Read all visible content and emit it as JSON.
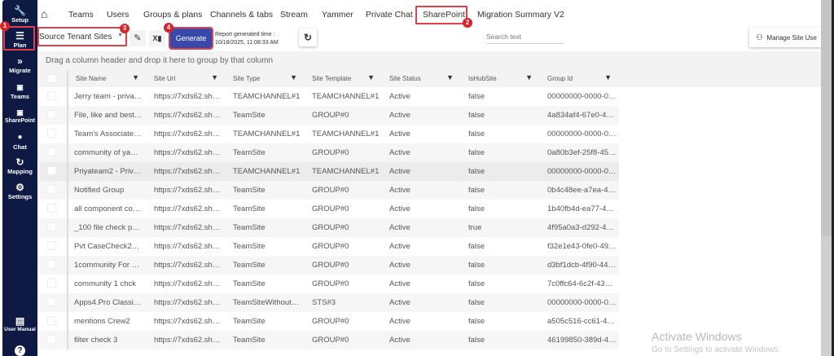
{
  "sidebar": {
    "items": [
      {
        "label": "Setup",
        "icon": "wrench-icon"
      },
      {
        "label": "Plan",
        "icon": "list-icon"
      },
      {
        "label": "Migrate",
        "icon": "double-chevron-icon"
      },
      {
        "label": "Teams",
        "icon": "teams-icon"
      },
      {
        "label": "SharePoint",
        "icon": "sharepoint-icon"
      },
      {
        "label": "Chat",
        "icon": "chat-icon"
      },
      {
        "label": "Mapping",
        "icon": "sync-icon"
      },
      {
        "label": "Settings",
        "icon": "gear-icon"
      },
      {
        "label": "User Manual",
        "icon": "book-icon"
      }
    ]
  },
  "nav": {
    "tabs": [
      "Teams",
      "Users",
      "Groups & plans",
      "Channels & tabs",
      "Stream",
      "Yammer",
      "Private Chat",
      "SharePoint",
      "Migration Summary V2"
    ],
    "active": "SharePoint"
  },
  "annotations": [
    "1",
    "2",
    "3",
    "4"
  ],
  "toolbar": {
    "report_select": "Source Tenant Sites",
    "generate_label": "Generate",
    "report_time_label": "Report generated time :",
    "report_time": "10/18/2025, 11:08:33 AM",
    "search_placeholder": "Search text",
    "manage_label": "Manage Site Use"
  },
  "grid": {
    "group_hint": "Drag a column header and drop it here to group by that column",
    "columns": [
      "Site Name",
      "Site Url",
      "Site Type",
      "Site Template",
      "Site Status",
      "IsHubSite",
      "Group Id"
    ],
    "rows": [
      [
        "Jerry team - priva…",
        "https://7xds62.sh…",
        "TEAMCHANNEL#1",
        "TEAMCHANNEL#1",
        "Active",
        "false",
        "00000000-0000-0…"
      ],
      [
        "File, like and best…",
        "https://7xds62.sh…",
        "TeamSite",
        "GROUP#0",
        "Active",
        "false",
        "4a834af4-67e0-4…"
      ],
      [
        "Team's Associate…",
        "https://7xds62.sh…",
        "TEAMCHANNEL#1",
        "TEAMCHANNEL#1",
        "Active",
        "false",
        "00000000-0000-0…"
      ],
      [
        "community of ya…",
        "https://7xds62.sh…",
        "TeamSite",
        "GROUP#0",
        "Active",
        "false",
        "0a80b3ef-25f8-45…"
      ],
      [
        "Priyateam2 - Priv…",
        "https://7xds62.sh…",
        "TEAMCHANNEL#1",
        "TEAMCHANNEL#1",
        "Active",
        "false",
        "00000000-0000-0…"
      ],
      [
        "Notified Group",
        "https://7xds62.sh…",
        "TeamSite",
        "GROUP#0",
        "Active",
        "false",
        "0b4c48ee-a7ea-4…"
      ],
      [
        "all component co…",
        "https://7xds62.sh…",
        "TeamSite",
        "GROUP#0",
        "Active",
        "false",
        "1b40fb4d-ea77-4…"
      ],
      [
        "_100 file check p…",
        "https://7xds62.sh…",
        "TeamSite",
        "GROUP#0",
        "Active",
        "true",
        "4f95a0a3-d292-4…"
      ],
      [
        "Pvt CaseCheck2…",
        "https://7xds62.sh…",
        "TeamSite",
        "GROUP#0",
        "Active",
        "false",
        "f32e1e43-0fe0-49…"
      ],
      [
        "1community For …",
        "https://7xds62.sh…",
        "TeamSite",
        "GROUP#0",
        "Active",
        "false",
        "d3bf1dcb-4f90-44…"
      ],
      [
        "community 1 chck",
        "https://7xds62.sh…",
        "TeamSite",
        "GROUP#0",
        "Active",
        "false",
        "7c0ffc64-6c2f-43…"
      ],
      [
        "Apps4.Pro Classi…",
        "https://7xds62.sh…",
        "TeamSiteWithout…",
        "STS#3",
        "Active",
        "false",
        "00000000-0000-0…"
      ],
      [
        "mentions Crew2",
        "https://7xds62.sh…",
        "TeamSite",
        "GROUP#0",
        "Active",
        "false",
        "a505c516-cc61-4…"
      ],
      [
        "filter check 3",
        "https://7xds62.sh…",
        "TeamSite",
        "GROUP#0",
        "Active",
        "false",
        "46199850-389d-4…"
      ]
    ]
  },
  "watermark": {
    "title": "Activate Windows",
    "subtitle": "Go to Settings to activate Windows."
  },
  "colors": {
    "sidebar": "#0e1a44",
    "generate": "#3949ab",
    "annotation": "#d8232a"
  }
}
